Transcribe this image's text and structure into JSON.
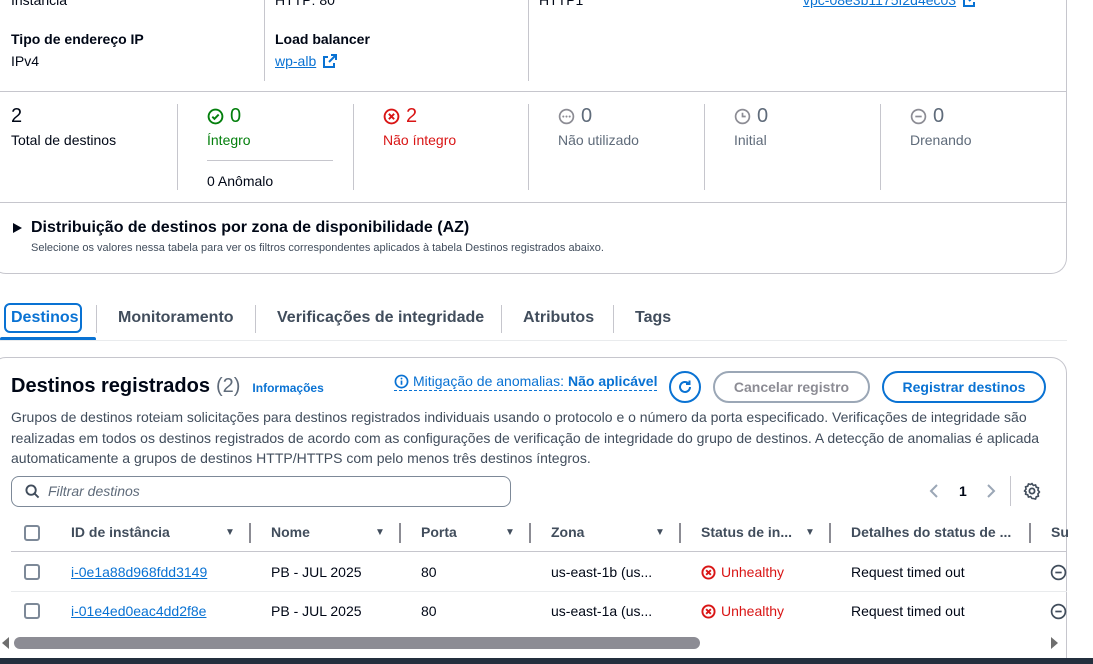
{
  "details": {
    "row1": {
      "col1_value": "Instância",
      "col2_value": "HTTP: 80",
      "col3_value": "HTTP1",
      "col4_link": "vpc-08e3b1175f2d4ec03"
    },
    "ip_type_label": "Tipo de endereço IP",
    "ip_type_value": "IPv4",
    "lb_label": "Load balancer",
    "lb_value": "wp-alb"
  },
  "stats": {
    "total": {
      "value": "2",
      "label": "Total de destinos"
    },
    "healthy": {
      "value": "0",
      "label": "Íntegro"
    },
    "anomalous": {
      "label": "0 Anômalo"
    },
    "unhealthy": {
      "value": "2",
      "label": "Não íntegro"
    },
    "unused": {
      "value": "0",
      "label": "Não utilizado"
    },
    "initial": {
      "value": "0",
      "label": "Initial"
    },
    "draining": {
      "value": "0",
      "label": "Drenando"
    }
  },
  "az": {
    "title": "Distribuição de destinos por zona de disponibilidade (AZ)",
    "description": "Selecione os valores nessa tabela para ver os filtros correspondentes aplicados à tabela Destinos registrados abaixo."
  },
  "tabs": [
    {
      "label": "Destinos",
      "active": true
    },
    {
      "label": "Monitoramento"
    },
    {
      "label": "Verificações de integridade"
    },
    {
      "label": "Atributos"
    },
    {
      "label": "Tags"
    }
  ],
  "registered": {
    "title": "Destinos registrados",
    "count": "(2)",
    "info_link": "Informações",
    "mitigation_prefix": "Mitigação de anomalias:",
    "mitigation_value": "Não aplicável",
    "cancel_button": "Cancelar registro",
    "register_button": "Registrar destinos",
    "description": "Grupos de destinos roteiam solicitações para destinos registrados individuais usando o protocolo e o número da porta especificado. Verificações de integridade são realizadas em todos os destinos registrados de acordo com as configurações de verificação de integridade do grupo de destinos. A detecção de anomalias é aplicada automaticamente a grupos de destinos HTTP/HTTPS com pelo menos três destinos íntegros.",
    "search_placeholder": "Filtrar destinos",
    "page": "1"
  },
  "table": {
    "headers": [
      "ID de instância",
      "Nome",
      "Porta",
      "Zona",
      "Status de in...",
      "Detalhes do status de ...",
      "Su"
    ],
    "rows": [
      {
        "id": "i-0e1a88d968fdd3149",
        "name": "PB - JUL 2025",
        "port": "80",
        "zone": "us-east-1b (us...",
        "status": "Unhealthy",
        "details": "Request timed out"
      },
      {
        "id": "i-01e4ed0eac4dd2f8e",
        "name": "PB - JUL 2025",
        "port": "80",
        "zone": "us-east-1a (us...",
        "status": "Unhealthy",
        "details": "Request timed out"
      }
    ]
  },
  "colors": {
    "link": "#0972d3",
    "success": "#037f0c",
    "error": "#d91515",
    "muted": "#5f6b7a"
  }
}
